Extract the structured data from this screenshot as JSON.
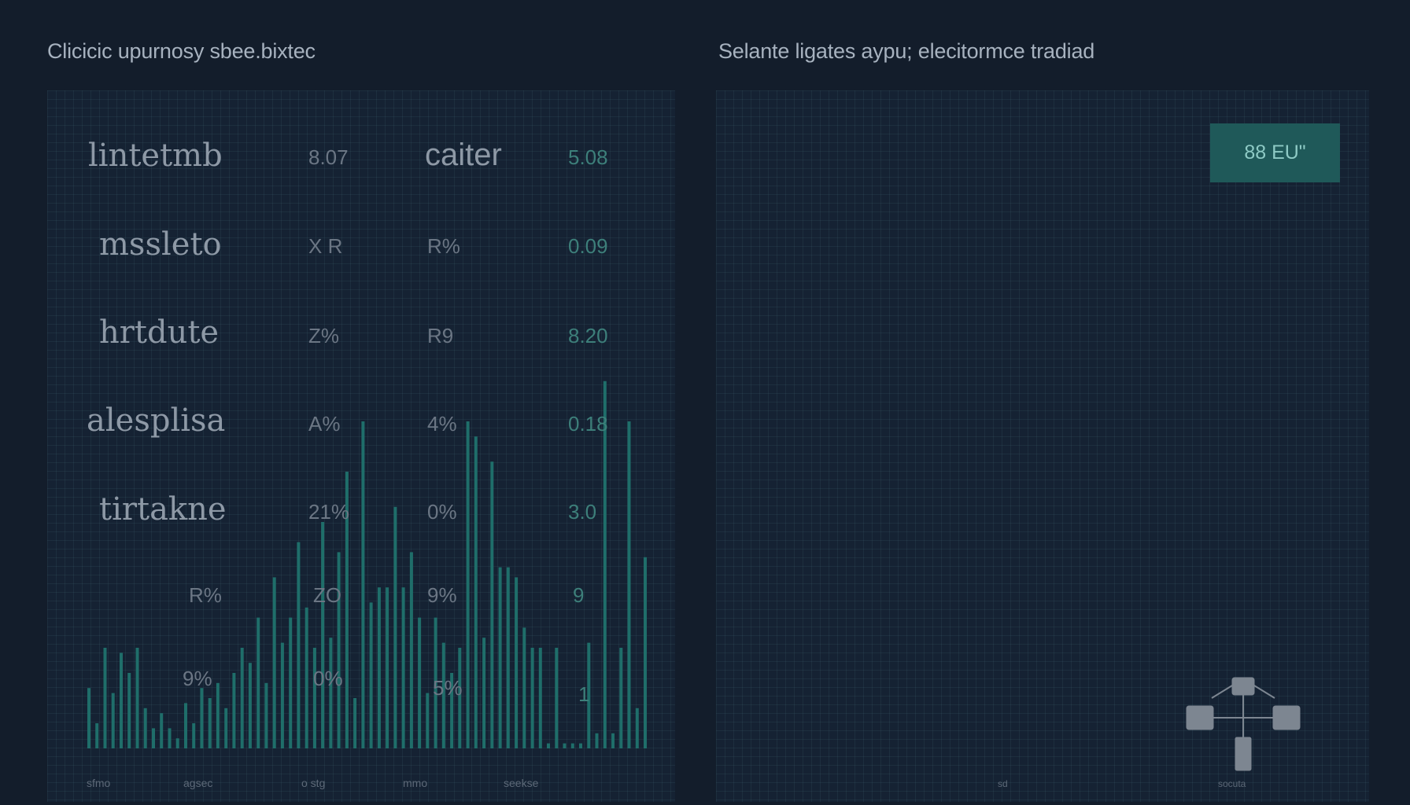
{
  "left_panel": {
    "title": "Clicicic upurnosy sbee.bixtec"
  },
  "right_panel": {
    "title": "Selante ligates aypu; elecitormce tradiad",
    "action_button": "88 EU\"",
    "tick_a": "sd",
    "tick_b": "socuta"
  },
  "table": {
    "header": {
      "label": "lintetmb",
      "c1": "8.07",
      "c2": "caiter",
      "c3": "5.08"
    },
    "rows": [
      {
        "label": "mssleto",
        "c1": "X R",
        "c2": "R%",
        "c3": "0.09"
      },
      {
        "label": "hrtdute",
        "c1": "Z%",
        "c2": "R9",
        "c3": "8.20"
      },
      {
        "label": "alesplisa",
        "c1": "A%",
        "c2": "4%",
        "c3": "0.18"
      },
      {
        "label": "tirtakne",
        "c1": "21%",
        "c2": "0%",
        "c3": "3.0"
      },
      {
        "label": "",
        "c0": "R%",
        "c1": "ZO",
        "c2": "9%",
        "c3": "9"
      },
      {
        "label": "",
        "c0": "9%",
        "c1": "0%",
        "c2": "5%",
        "c3": "1"
      }
    ]
  },
  "chart_data": {
    "type": "bar",
    "color": "#1f6e6a",
    "x_tick_labels": [
      "sfmo",
      "agsec",
      "o stg",
      "mmo",
      "seekse"
    ],
    "values": [
      0.12,
      0.05,
      0.2,
      0.11,
      0.19,
      0.15,
      0.2,
      0.08,
      0.04,
      0.07,
      0.04,
      0.02,
      0.09,
      0.05,
      0.12,
      0.1,
      0.13,
      0.08,
      0.15,
      0.2,
      0.17,
      0.26,
      0.13,
      0.34,
      0.21,
      0.26,
      0.41,
      0.28,
      0.2,
      0.45,
      0.22,
      0.39,
      0.55,
      0.1,
      0.65,
      0.29,
      0.32,
      0.32,
      0.48,
      0.32,
      0.39,
      0.26,
      0.11,
      0.26,
      0.21,
      0.15,
      0.2,
      0.65,
      0.62,
      0.22,
      0.57,
      0.36,
      0.36,
      0.34,
      0.24,
      0.2,
      0.2,
      0.01,
      0.2,
      0.01,
      0.01,
      0.01,
      0.21,
      0.03,
      0.73,
      0.03,
      0.2,
      0.65,
      0.08,
      0.38
    ],
    "ylim": [
      0,
      1
    ]
  }
}
